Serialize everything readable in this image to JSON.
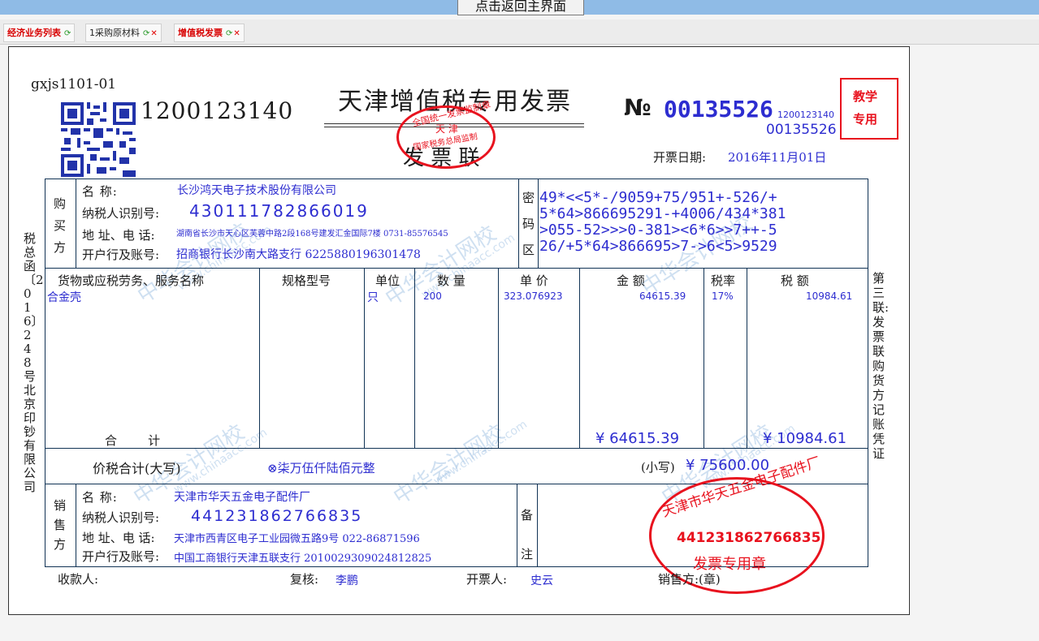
{
  "topbar": {
    "back_button": "点击返回主界面"
  },
  "tabs": [
    {
      "label": "经济业务列表",
      "closable": false,
      "style": "red"
    },
    {
      "label": "1采购原材料",
      "closable": true,
      "style": "dark"
    },
    {
      "label": "增值税发票",
      "closable": true,
      "style": "red"
    }
  ],
  "invoice": {
    "form_code": "gxjs1101-01",
    "invoice_code": "1200123140",
    "title": "天津增值税专用发票",
    "copy_name": "发 票 联",
    "no_symbol": "№",
    "number": "00135526",
    "code_small": "1200123140",
    "number_small": "00135526",
    "teaching_stamp": [
      "教学",
      "专用"
    ],
    "issue_date_label": "开票日期:",
    "issue_date": "2016年11月01日",
    "left_margin_text": "税总函〔2016〕248号北京印钞有限公司",
    "right_margin_text": "第三联:发票联 购货方记账凭证",
    "tax_seal": {
      "line1": "全国统一发票监制章",
      "line2": "天 津",
      "line3": "国家税务总局监制"
    },
    "buyer": {
      "section": "购买方",
      "name_label": "名 称:",
      "name": "长沙鸿天电子技术股份有限公司",
      "tax_id_label": "纳税人识别号:",
      "tax_id": "430111782866019",
      "address_label": "地 址、电 话:",
      "address": "湖南省长沙市天心区芙蓉中路2段168号建发汇金国际7楼  0731-85576545",
      "bank_label": "开户行及账号:",
      "bank": "招商银行长沙南大路支行  6225880196301478"
    },
    "cipher": {
      "section": "密码区",
      "lines": [
        "49*<<5*-/9059+75/951+-526/+",
        "5*64>866695291-+4006/434*381",
        ">055-52>>>0-381><6*6>>7++-5",
        "26/+5*64>866695>7->6<5>9529"
      ]
    },
    "columns": [
      "货物或应税劳务、服务名称",
      "规格型号",
      "单位",
      "数 量",
      "单 价",
      "金  额",
      "税率",
      "税  额"
    ],
    "items": [
      {
        "name": "合金壳",
        "spec": "",
        "unit": "只",
        "qty": "200",
        "price": "323.076923",
        "amount": "64615.39",
        "rate": "17%",
        "tax": "10984.61"
      }
    ],
    "total_label": "合        计",
    "total_amount": "¥ 64615.39",
    "total_tax": "¥ 10984.61",
    "grand_total_label": "价税合计(大写)",
    "grand_total_words": "⊗柒万伍仟陆佰元整",
    "grand_total_small_label": "(小写)",
    "grand_total_small": "¥ 75600.00",
    "seller": {
      "section": "销售方",
      "name_label": "名 称:",
      "name": "天津市华天五金电子配件厂",
      "tax_id_label": "纳税人识别号:",
      "tax_id": "441231862766835",
      "address_label": "地 址、电 话:",
      "address": "天津市西青区电子工业园微五路9号  022-86871596",
      "bank_label": "开户行及账号:",
      "bank": "中国工商银行天津五联支行  2010029309024812825"
    },
    "remarks_section": "备注",
    "seller_stamp": {
      "name": "天津市华天五金电子配件厂",
      "tax_id": "441231862766835",
      "label": "发票专用章"
    },
    "footer": {
      "payee_label": "收款人:",
      "payee": "",
      "reviewer_label": "复核:",
      "reviewer": "李鹏",
      "drawer_label": "开票人:",
      "drawer": "史云",
      "seller_label": "销售方:(章)"
    },
    "watermark": {
      "text1": "中华会计网校",
      "text2": "www.chinaacc.com"
    }
  },
  "colors": {
    "ink_blue": "#2d2dd0",
    "stamp_red": "#e8121e",
    "table_line": "#113355",
    "topbar": "#8fbbe6"
  }
}
